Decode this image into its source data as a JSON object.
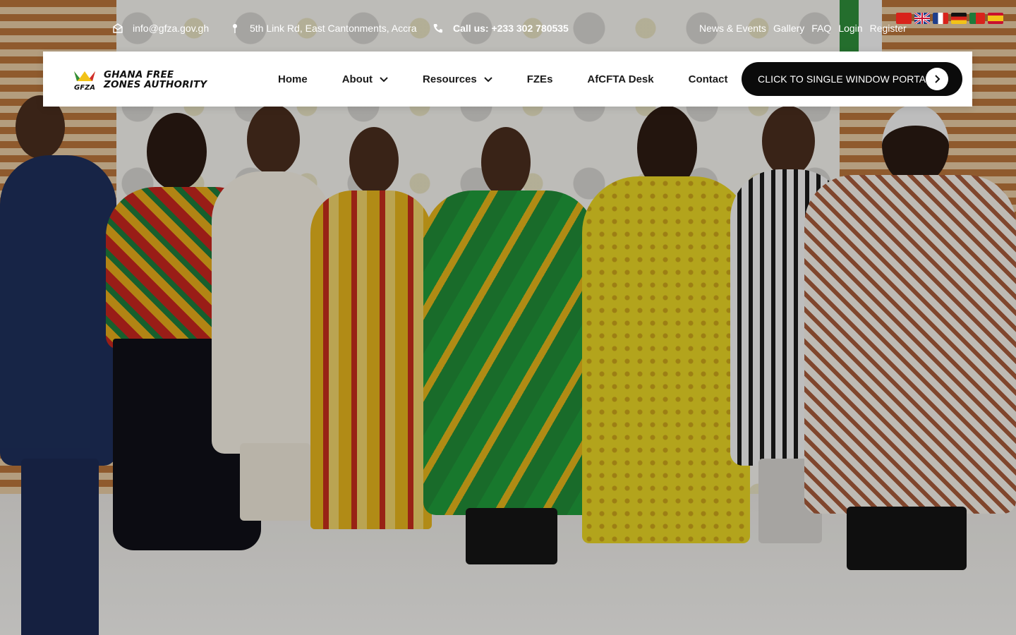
{
  "topbar": {
    "email": "info@gfza.gov.gh",
    "address": "5th Link Rd, East Cantonments, Accra",
    "phone": "Call us: +233 302 780535",
    "links": [
      "News & Events",
      "Gallery",
      "FAQ",
      "Login",
      "Register"
    ],
    "languages": [
      "chinese-flag",
      "uk-flag",
      "france-flag",
      "germany-flag",
      "portugal-flag",
      "spain-flag"
    ]
  },
  "brand": {
    "logo_mark": "GFZA",
    "name_line1": "GHANA FREE",
    "name_line2": "ZONES AUTHORITY"
  },
  "nav": {
    "items": [
      {
        "label": "Home",
        "dropdown": false
      },
      {
        "label": "About",
        "dropdown": true
      },
      {
        "label": "Resources",
        "dropdown": true
      },
      {
        "label": "FZEs",
        "dropdown": false
      },
      {
        "label": "AfCFTA Desk",
        "dropdown": false
      },
      {
        "label": "Contact",
        "dropdown": false
      }
    ],
    "cta_label": "CLICK TO SINGLE WINDOW PORTAL"
  },
  "colors": {
    "nav_bg": "#ffffff",
    "cta_bg": "#0b0b0b",
    "brand_green": "#2f8d3a",
    "brand_yellow": "#f2c318",
    "brand_red": "#d02c2c"
  }
}
